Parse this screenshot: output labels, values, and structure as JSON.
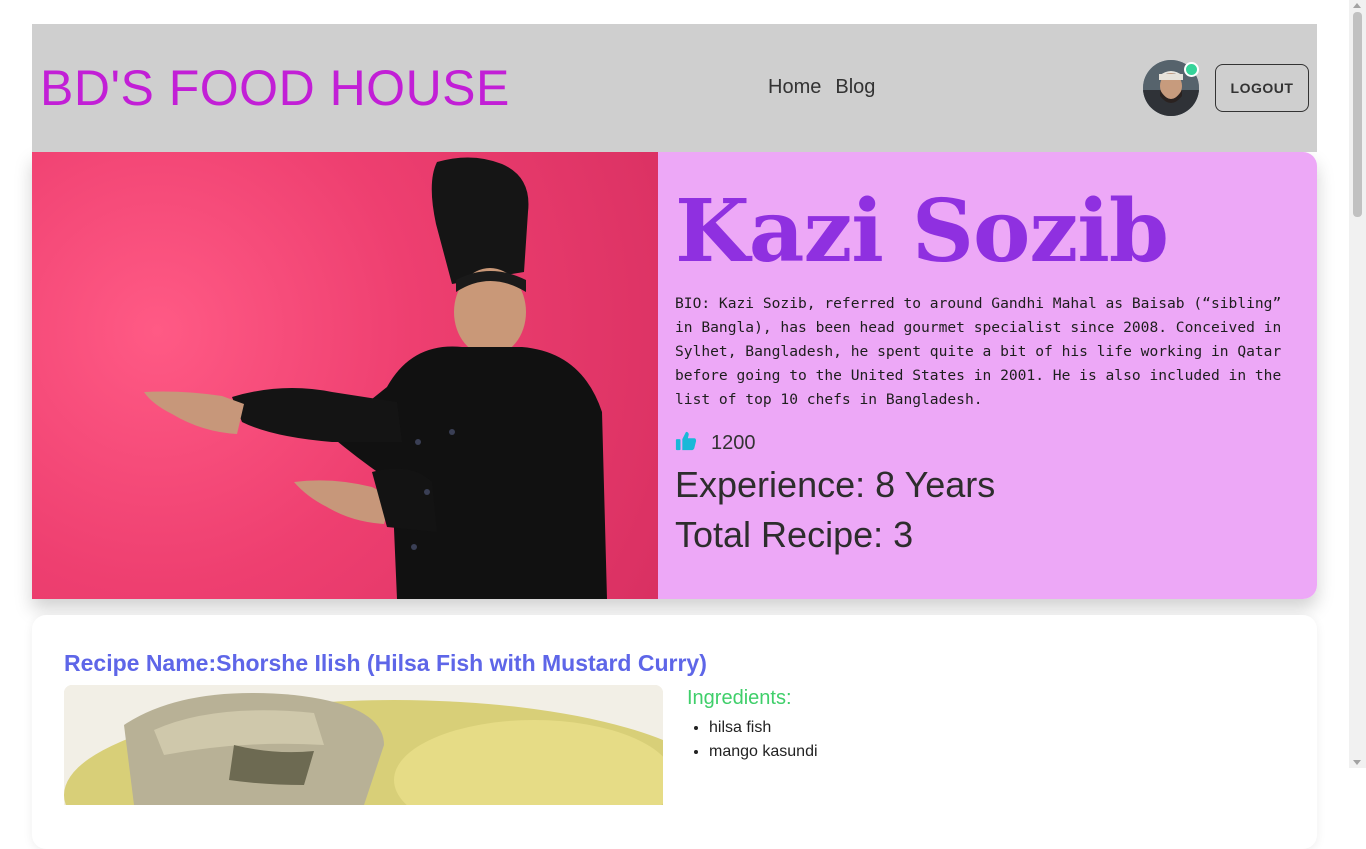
{
  "header": {
    "brand": "BD'S FOOD HOUSE",
    "nav": [
      "Home",
      "Blog"
    ],
    "logout_label": "LOGOUT"
  },
  "chef": {
    "name": "Kazi Sozib",
    "bio": "BIO: Kazi Sozib, referred to around Gandhi Mahal as Baisab (“sibling” in Bangla), has been head gourmet specialist since 2008. Conceived in Sylhet, Bangladesh, he spent quite a bit of his life working in Qatar before going to the United States in 2001. He is also included in the list of top 10 chefs in Bangladesh.",
    "likes": "1200",
    "experience": "Experience: 8 Years",
    "total_recipe": "Total Recipe: 3"
  },
  "recipe": {
    "title": "Recipe Name:Shorshe Ilish (Hilsa Fish with Mustard Curry)",
    "ingredients_title": "Ingredients:",
    "ingredients": [
      "hilsa fish",
      "mango kasundi"
    ]
  },
  "colors": {
    "brand": "#c21fd6",
    "hero_bg": "#eda8f7",
    "chef_name": "#8f30e0",
    "recipe_title": "#5e66e8",
    "ingredients_title": "#3fcf6a",
    "like_icon": "#19b8d8"
  }
}
